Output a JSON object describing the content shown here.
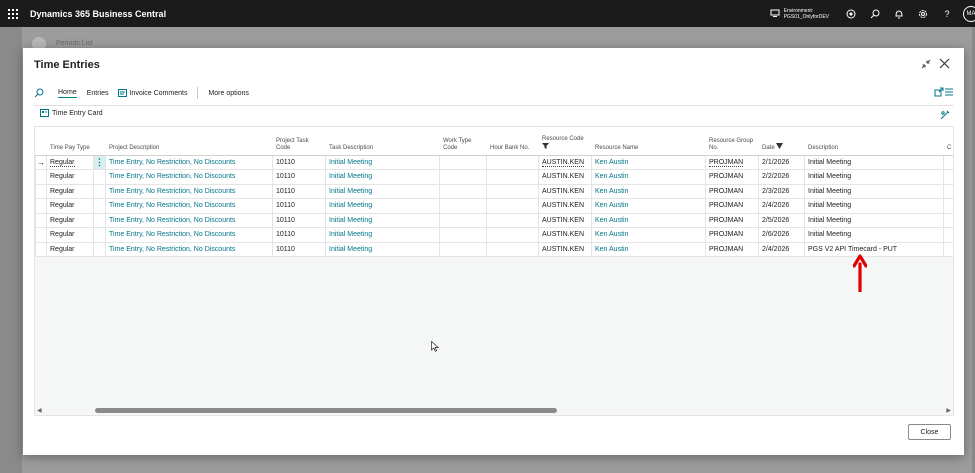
{
  "appbar": {
    "title": "Dynamics 365 Business Central",
    "environment_label": "Environment:",
    "environment_name": "PGS01_OnlyforDEV",
    "avatar_initials": "MA"
  },
  "background_page": {
    "title": "Periods List"
  },
  "dialog": {
    "title": "Time Entries",
    "actions": {
      "home": "Home",
      "entries": "Entries",
      "invoice_comments": "Invoice Comments",
      "more_options": "More options"
    },
    "card_action": "Time Entry Card",
    "close_label": "Close"
  },
  "grid": {
    "headers": {
      "time_pay_type": "Time Pay Type",
      "project_description": "Project Description",
      "project_task_code": "Project Task Code",
      "task_description": "Task Description",
      "work_type_code": "Work Type Code",
      "hour_bank_no": "Hour Bank No.",
      "resource_code": "Resource Code",
      "resource_name": "Resource Name",
      "resource_group_no": "Resource Group No.",
      "date": "Date",
      "description": "Description",
      "overflow": "C"
    },
    "rows": [
      {
        "time_pay_type": "Regular",
        "project_description": "Time Entry, No Restriction, No Discounts",
        "project_task_code": "10110",
        "task_description": "Initial Meeting",
        "work_type_code": "",
        "hour_bank_no": "",
        "resource_code": "AUSTIN.KEN",
        "resource_name": "Ken Austin",
        "resource_group_no": "PROJMAN",
        "date": "2/1/2026",
        "description": "Initial Meeting"
      },
      {
        "time_pay_type": "Regular",
        "project_description": "Time Entry, No Restriction, No Discounts",
        "project_task_code": "10110",
        "task_description": "Initial Meeting",
        "work_type_code": "",
        "hour_bank_no": "",
        "resource_code": "AUSTIN.KEN",
        "resource_name": "Ken Austin",
        "resource_group_no": "PROJMAN",
        "date": "2/2/2026",
        "description": "Initial Meeting"
      },
      {
        "time_pay_type": "Regular",
        "project_description": "Time Entry, No Restriction, No Discounts",
        "project_task_code": "10110",
        "task_description": "Initial Meeting",
        "work_type_code": "",
        "hour_bank_no": "",
        "resource_code": "AUSTIN.KEN",
        "resource_name": "Ken Austin",
        "resource_group_no": "PROJMAN",
        "date": "2/3/2026",
        "description": "Initial Meeting"
      },
      {
        "time_pay_type": "Regular",
        "project_description": "Time Entry, No Restriction, No Discounts",
        "project_task_code": "10110",
        "task_description": "Initial Meeting",
        "work_type_code": "",
        "hour_bank_no": "",
        "resource_code": "AUSTIN.KEN",
        "resource_name": "Ken Austin",
        "resource_group_no": "PROJMAN",
        "date": "2/4/2026",
        "description": "Initial Meeting"
      },
      {
        "time_pay_type": "Regular",
        "project_description": "Time Entry, No Restriction, No Discounts",
        "project_task_code": "10110",
        "task_description": "Initial Meeting",
        "work_type_code": "",
        "hour_bank_no": "",
        "resource_code": "AUSTIN.KEN",
        "resource_name": "Ken Austin",
        "resource_group_no": "PROJMAN",
        "date": "2/5/2026",
        "description": "Initial Meeting"
      },
      {
        "time_pay_type": "Regular",
        "project_description": "Time Entry, No Restriction, No Discounts",
        "project_task_code": "10110",
        "task_description": "Initial Meeting",
        "work_type_code": "",
        "hour_bank_no": "",
        "resource_code": "AUSTIN.KEN",
        "resource_name": "Ken Austin",
        "resource_group_no": "PROJMAN",
        "date": "2/6/2026",
        "description": "Initial Meeting"
      },
      {
        "time_pay_type": "Regular",
        "project_description": "Time Entry, No Restriction, No Discounts",
        "project_task_code": "10110",
        "task_description": "Initial Meeting",
        "work_type_code": "",
        "hour_bank_no": "",
        "resource_code": "AUSTIN.KEN",
        "resource_name": "Ken Austin",
        "resource_group_no": "PROJMAN",
        "date": "2/4/2026",
        "description": "PGS V2 API Timecard - PUT"
      }
    ]
  },
  "colors": {
    "accent": "#008489",
    "link": "#00768a",
    "appbar": "#1b1b1b",
    "annotation": "#e00000"
  }
}
